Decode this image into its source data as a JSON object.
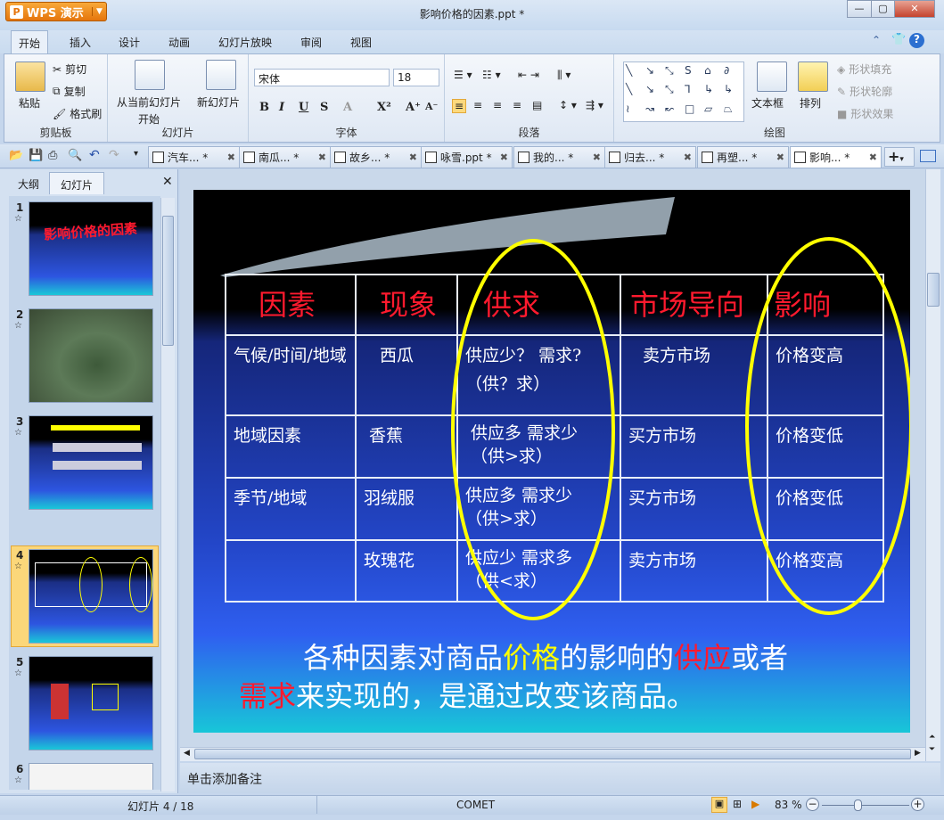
{
  "app": {
    "name": "WPS 演示",
    "title": "影响价格的因素.ppt *"
  },
  "menu": [
    "开始",
    "插入",
    "设计",
    "动画",
    "幻灯片放映",
    "审阅",
    "视图"
  ],
  "ribbon": {
    "clipboard": {
      "paste": "粘贴",
      "cut": "剪切",
      "copy": "复制",
      "format_painter": "格式刷",
      "label": "剪贴板"
    },
    "slides": {
      "from_current": "从当前幻灯片",
      "start": "开始",
      "new_slide": "新幻灯片",
      "label": "幻灯片"
    },
    "font": {
      "name": "宋体",
      "size": "18",
      "bold": "B",
      "italic": "I",
      "underline": "U",
      "strike": "S",
      "color": "A",
      "superscript": "X²",
      "grow": "A⁺",
      "shrink": "A⁻",
      "label": "字体"
    },
    "paragraph": {
      "label": "段落"
    },
    "drawing": {
      "textbox": "文本框",
      "arrange": "排列",
      "fill": "形状填充",
      "outline": "形状轮廓",
      "effect": "形状效果",
      "label": "绘图"
    }
  },
  "doc_tabs": [
    "汽车... *",
    "南瓜... *",
    "故乡... *",
    "咏雪.ppt *",
    "我的... *",
    "归去... *",
    "再塑... *",
    "影响... *"
  ],
  "left_panel": {
    "tabs": [
      "大纲",
      "幻灯片"
    ],
    "slide_numbers": [
      "1",
      "2",
      "3",
      "4",
      "5",
      "6"
    ],
    "thumb1_title": "影响价格的因素"
  },
  "slide": {
    "headers": [
      "因素",
      "现象",
      "供求",
      "市场导向",
      "影响"
    ],
    "rows": [
      [
        "气候/时间/地域",
        "西瓜",
        "供应少？ 需求?",
        "（供？求）",
        "卖方市场",
        "价格变高"
      ],
      [
        "地域因素",
        "香蕉",
        "供应多  需求少",
        "（供>求）",
        "买方市场",
        "价格变低"
      ],
      [
        "季节/地域",
        "羽绒服",
        "供应多 需求少",
        "（供>求）",
        "买方市场",
        "价格变低"
      ],
      [
        "",
        "玫瑰花",
        "供应少 需求多",
        "（供<求）",
        "卖方市场",
        "价格变高"
      ]
    ],
    "bottom": {
      "p1": "各种因素对商品",
      "p2": "价格",
      "p3": "的影响的",
      "p4": "供应",
      "p5": "或者",
      "p6": "需求",
      "p7": "来实现的，是通过改变该商品。"
    }
  },
  "notes_placeholder": "单击添加备注",
  "status": {
    "slide": "幻灯片 4 / 18",
    "theme": "COMET",
    "zoom": "83 %"
  },
  "colors": {
    "header_red": "#ff1a2e",
    "highlight_yellow": "#ffff00"
  }
}
